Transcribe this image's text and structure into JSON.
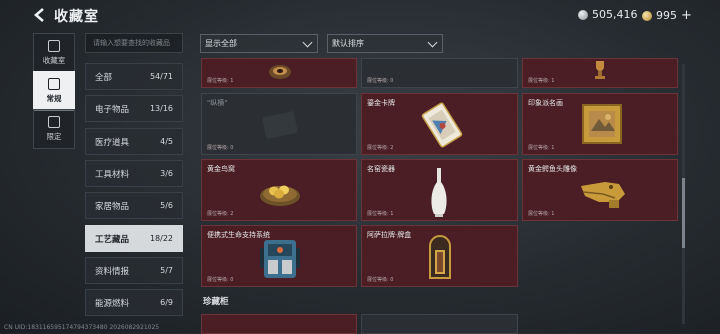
{
  "header": {
    "title": "收藏室",
    "currency1": "505,416",
    "currency2": "995",
    "plus": "+"
  },
  "rail": [
    {
      "label": "收藏室",
      "icon": "collection-icon"
    },
    {
      "label": "常规",
      "icon": "regular-icon"
    },
    {
      "label": "限定",
      "icon": "limited-icon"
    }
  ],
  "search": {
    "placeholder": "请输入想要查找的收藏品"
  },
  "categories": [
    {
      "label": "全部",
      "count": "54/71"
    },
    {
      "label": "电子物品",
      "count": "13/16"
    },
    {
      "label": "医疗道具",
      "count": "4/5"
    },
    {
      "label": "工具材料",
      "count": "3/6"
    },
    {
      "label": "家居物品",
      "count": "5/6"
    },
    {
      "label": "工艺藏品",
      "count": "18/22"
    },
    {
      "label": "资料情报",
      "count": "5/7"
    },
    {
      "label": "能源燃料",
      "count": "6/9"
    }
  ],
  "filters": {
    "show": "显示全部",
    "sort": "默认排序"
  },
  "cards": [
    {
      "name": "",
      "level": "展位等级: 1"
    },
    {
      "name": "",
      "level": "展位等级: 0"
    },
    {
      "name": "",
      "level": "展位等级: 1"
    },
    {
      "name": "\"纵横\"",
      "level": "展位等级: 0"
    },
    {
      "name": "鎏金卡牌",
      "level": "展位等级: 2"
    },
    {
      "name": "印象派名画",
      "level": "展位等级: 1"
    },
    {
      "name": "黄金鸟窝",
      "level": "展位等级: 2"
    },
    {
      "name": "名窑瓷器",
      "level": "展位等级: 1"
    },
    {
      "name": "黄金鳄鱼头雕像",
      "level": "展位等级: 1"
    },
    {
      "name": "便携式生命支持系统",
      "level": "展位等级: 0"
    },
    {
      "name": "阿萨拉牌·牌盒",
      "level": "展位等级: 0"
    }
  ],
  "shelf_title": "珍藏柜",
  "footer": "CN UID:183116595174794373480 2026082921025"
}
